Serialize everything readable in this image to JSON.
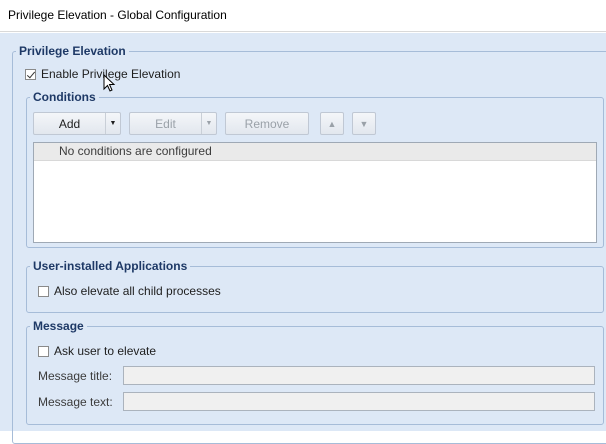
{
  "window": {
    "title": "Privilege Elevation - Global Configuration"
  },
  "privilege_group": {
    "legend": "Privilege Elevation",
    "enable_checkbox": {
      "label": "Enable Privilege Elevation",
      "checked": true
    }
  },
  "conditions": {
    "legend": "Conditions",
    "toolbar": {
      "add_label": "Add",
      "edit_label": "Edit",
      "remove_label": "Remove",
      "move_up_icon": "triangle-up-icon",
      "move_down_icon": "triangle-down-icon"
    },
    "list_header": "No conditions are configured"
  },
  "user_apps": {
    "legend": "User-installed Applications",
    "child_processes": {
      "label": "Also elevate all child processes",
      "checked": false
    }
  },
  "message": {
    "legend": "Message",
    "ask_user": {
      "label": "Ask user to elevate",
      "checked": false
    },
    "title_label": "Message title:",
    "title_value": "",
    "text_label": "Message text:",
    "text_value": ""
  },
  "colors": {
    "panel_bg": "#dde8f6",
    "group_border": "#a6bcd8",
    "legend_text": "#1e3966"
  }
}
